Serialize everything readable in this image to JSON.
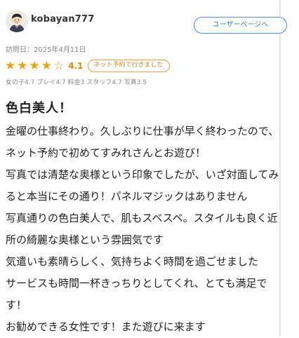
{
  "reviewer": {
    "username": "kobayan777",
    "user_page_button": "ユーザーページへ"
  },
  "visit": {
    "date_label": "訪問日：2025年4月11日"
  },
  "rating": {
    "stars_filled": 4,
    "stars_total": 5,
    "score": "4.1",
    "badge": "ネット予約で行きました",
    "star_color": "#e9a217"
  },
  "sub_scores": [
    "女の子4.7",
    "プレイ4.7",
    "料金3",
    "スタッフ4.7",
    "写真3.5"
  ],
  "review": {
    "title": "色白美人！",
    "lines": [
      "金曜の仕事終わり。久しぶりに仕事が早く終わったので、",
      "ネット予約で初めてすみれさんとお遊び！",
      "写真では清楚な奥様という印象でしたが、いざ対面してみ",
      "ると本当にその通り！パネルマジックはありません",
      "写真通りの色白美人で、肌もスベスベ。スタイルも良く近",
      "所の綺麗な奥様という雰囲気です",
      "気遣いも素晴らしく、気持ちよく時間を過ごせました",
      "サービスも時間一杯きっちりとしてくれ、とても満足で",
      "す！",
      "お勧めできる女性です！また遊びに来ます"
    ]
  },
  "colors": {
    "accent_blue": "#4a8fd6",
    "accent_orange": "#e6a13a"
  }
}
